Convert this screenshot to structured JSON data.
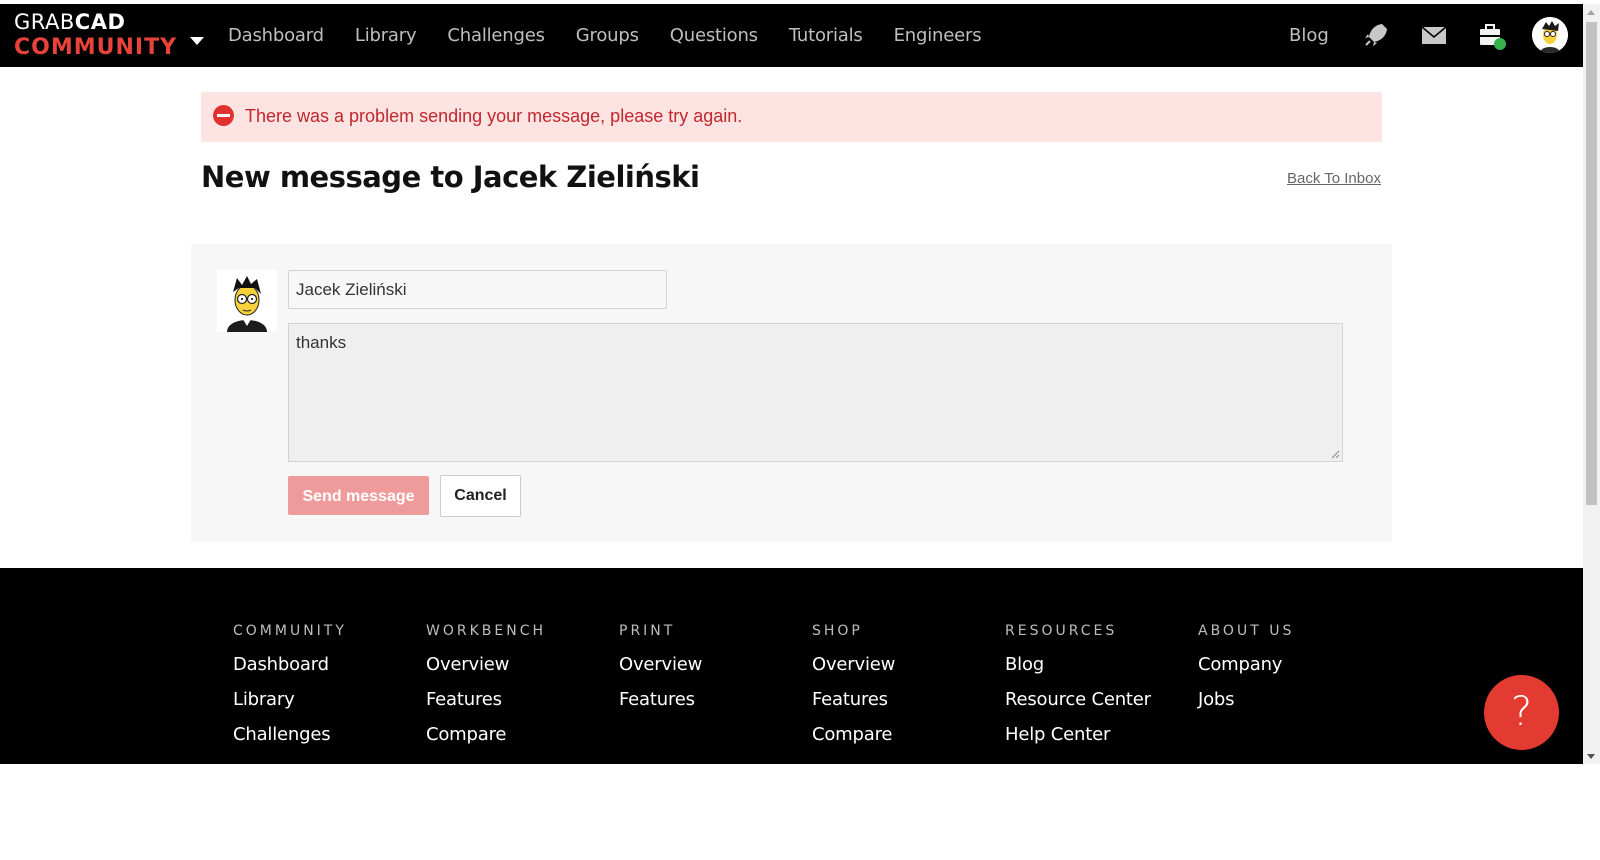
{
  "header": {
    "logo_top_light": "GRAB",
    "logo_top_bold": "CAD",
    "logo_bottom": "COMMUNITY",
    "nav": [
      "Dashboard",
      "Library",
      "Challenges",
      "Groups",
      "Questions",
      "Tutorials",
      "Engineers"
    ],
    "blog": "Blog",
    "icons": [
      "rocket-icon",
      "mail-icon",
      "briefcase-icon",
      "avatar"
    ]
  },
  "alert": {
    "text": "There was a problem sending your message, please try again.",
    "icon": "error-icon"
  },
  "page": {
    "title": "New message to Jacek Zieliński",
    "back_link": "Back To Inbox"
  },
  "form": {
    "recipient": "Jacek Zieliński",
    "message": "thanks",
    "send_label": "Send message",
    "cancel_label": "Cancel"
  },
  "footer": {
    "columns": [
      {
        "heading": "COMMUNITY",
        "links": [
          "Dashboard",
          "Library",
          "Challenges"
        ]
      },
      {
        "heading": "WORKBENCH",
        "links": [
          "Overview",
          "Features",
          "Compare"
        ]
      },
      {
        "heading": "PRINT",
        "links": [
          "Overview",
          "Features"
        ]
      },
      {
        "heading": "SHOP",
        "links": [
          "Overview",
          "Features",
          "Compare"
        ]
      },
      {
        "heading": "RESOURCES",
        "links": [
          "Blog",
          "Resource Center",
          "Help Center"
        ]
      },
      {
        "heading": "ABOUT US",
        "links": [
          "Company",
          "Jobs"
        ]
      }
    ],
    "help_label": "?"
  },
  "colors": {
    "brand_red": "#e8433a",
    "alert_bg": "#fde4e2",
    "alert_text": "#c1272d",
    "send_button": "#ef9b9b"
  }
}
